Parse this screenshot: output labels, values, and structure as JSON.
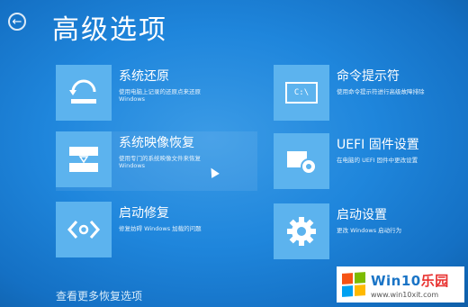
{
  "header": {
    "back_icon": "back-arrow-icon",
    "title": "高级选项"
  },
  "options": [
    {
      "label": "系统还原",
      "desc1": "使用电脑上记录的还原点来还原",
      "desc2": "Windows",
      "icon": "system-restore-icon"
    },
    {
      "label": "命令提示符",
      "desc1": "使用命令提示符进行高级故障排除",
      "desc2": "",
      "icon": "command-prompt-icon",
      "icon_text": "C:\\"
    },
    {
      "label": "系统映像恢复",
      "desc1": "使用专门的系统映像文件来恢复",
      "desc2": "Windows",
      "icon": "system-image-icon"
    },
    {
      "label": "UEFI 固件设置",
      "desc1": "在电脑的 UEFI 固件中更改设置",
      "desc2": "",
      "icon": "uefi-firmware-icon"
    },
    {
      "label": "启动修复",
      "desc1": "修复妨碍 Windows 加载的问题",
      "desc2": "",
      "icon": "startup-repair-icon"
    },
    {
      "label": "启动设置",
      "desc1": "更改 Windows 启动行为",
      "desc2": "",
      "icon": "startup-settings-gear-icon"
    }
  ],
  "more_link": "查看更多恢复选项",
  "watermark": {
    "brand_prefix": "Win",
    "brand_mid": "10",
    "brand_suffix": "乐园",
    "url": "www.win10xit.com",
    "colors": {
      "blue": "#1a74c6",
      "red": "#e8312f",
      "green": "#7cbb00",
      "yellow": "#ffb900",
      "flag_blue": "#00a1f1",
      "flag_red": "#f65314"
    }
  },
  "colors": {
    "background": "#1f86dc",
    "tile": "#5cb3ee"
  }
}
